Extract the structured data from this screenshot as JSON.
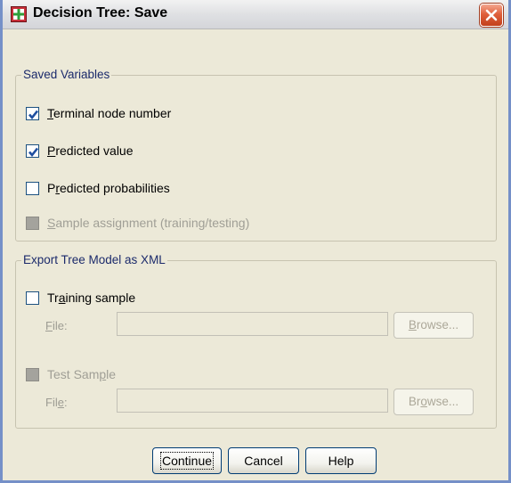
{
  "window": {
    "title": "Decision Tree: Save"
  },
  "saved_variables": {
    "legend": "Saved Variables",
    "terminal_node": {
      "pre": "",
      "key": "T",
      "post": "erminal node number",
      "checked": true
    },
    "predicted_value": {
      "pre": "",
      "key": "P",
      "post": "redicted value",
      "checked": true
    },
    "predicted_probabilities": {
      "pre": "P",
      "key": "r",
      "post": "edicted probabilities",
      "checked": false
    },
    "sample_assignment": {
      "pre": "",
      "key": "S",
      "post": "ample assignment (training/testing)",
      "checked": false,
      "disabled": true
    }
  },
  "export": {
    "legend": "Export Tree Model as XML",
    "training_sample": {
      "pre": "Tr",
      "key": "a",
      "post": "ining sample",
      "checked": false
    },
    "training_file": {
      "key": "F",
      "post": "ile:",
      "value": ""
    },
    "training_browse": {
      "pre": "",
      "key": "B",
      "post": "rowse..."
    },
    "test_sample": {
      "pre": "Test Sam",
      "key": "p",
      "post": "le",
      "checked": false,
      "disabled": true
    },
    "test_file": {
      "pre": "Fil",
      "key": "e",
      "post": ":",
      "value": ""
    },
    "test_browse": {
      "pre": "Br",
      "key": "o",
      "post": "wse..."
    }
  },
  "buttons": {
    "continue": "Continue",
    "cancel": "Cancel",
    "help": "Help"
  },
  "icons": {
    "app": "decision-tree-app-icon",
    "close": "close-x-icon",
    "check": "checkmark-icon"
  },
  "colors": {
    "check": "#1f4fa0",
    "close": "#e0603c",
    "legend": "#1b2a6b"
  }
}
